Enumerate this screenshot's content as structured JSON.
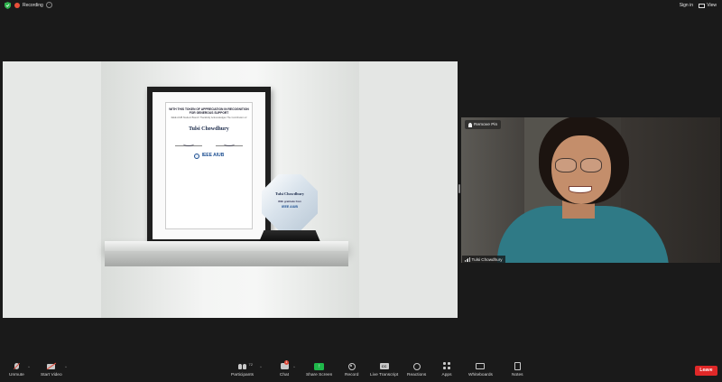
{
  "topbar": {
    "recording_label": "Recording",
    "signin_label": "Sign in",
    "view_label": "View"
  },
  "shared_screen": {
    "certificate": {
      "heading": "WITH THIS TOKEN OF APPRECIATION IN RECOGNITION FOR GENEROUS SUPPORT",
      "subheading": "IEEE AIUB Student Branch Thankfully Acknowledges The Contribution of",
      "recipient": "Tulsi Chowdhury",
      "brand": "IEEE AIUB"
    },
    "plaque": {
      "recipient": "Tulsi Chowdhury",
      "gratitude": "With gratitude from",
      "brand": "IEEE AIUB"
    }
  },
  "participant_video": {
    "remove_pin_label": "Remove Pin",
    "name": "Tulsi Chowdhury"
  },
  "toolbar": {
    "unmute": "Unmute",
    "start_video": "Start Video",
    "participants": "Participants",
    "participants_count": "72",
    "chat": "Chat",
    "chat_badge": "1",
    "share_screen": "Share Screen",
    "record": "Record",
    "live_transcript": "Live Transcript",
    "cc_glyph": "CC",
    "reactions": "Reactions",
    "apps": "Apps",
    "whiteboards": "Whiteboards",
    "notes": "Notes",
    "leave": "Leave"
  },
  "colors": {
    "background": "#1a1a1a",
    "share_green": "#1fb84a",
    "leave_red": "#e02828",
    "recording_red": "#e8503a",
    "shield_green": "#2fb34e"
  }
}
